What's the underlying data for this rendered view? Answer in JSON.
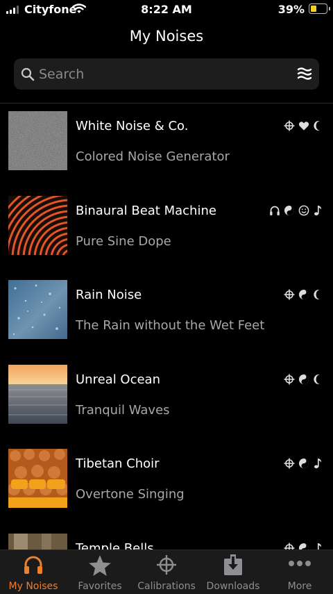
{
  "status": {
    "carrier": "Cityfone",
    "time": "8:22 AM",
    "battery": "39%",
    "battery_level": 0.39
  },
  "header": {
    "title": "My Noises"
  },
  "search": {
    "placeholder": "Search"
  },
  "items": [
    {
      "name": "White Noise & Co.",
      "subtitle": "Colored Noise Generator",
      "tags": [
        "crosshair-icon",
        "heart-icon",
        "moon-icon"
      ]
    },
    {
      "name": "Binaural Beat Machine",
      "subtitle": "Pure Sine Dope",
      "tags": [
        "headphones-icon",
        "yin-yang-icon",
        "smiley-icon",
        "music-note-icon"
      ]
    },
    {
      "name": "Rain Noise",
      "subtitle": "The Rain without the Wet Feet",
      "tags": [
        "crosshair-icon",
        "yin-yang-icon",
        "moon-icon"
      ]
    },
    {
      "name": "Unreal Ocean",
      "subtitle": "Tranquil Waves",
      "tags": [
        "crosshair-icon",
        "yin-yang-icon",
        "moon-icon"
      ]
    },
    {
      "name": "Tibetan Choir",
      "subtitle": "Overtone Singing",
      "tags": [
        "crosshair-icon",
        "yin-yang-icon",
        "music-note-icon"
      ]
    },
    {
      "name": "Temple Bells",
      "subtitle": "",
      "tags": [
        "crosshair-icon",
        "yin-yang-icon",
        "music-note-icon"
      ]
    }
  ],
  "tabs": [
    {
      "label": "My Noises",
      "icon": "headphones-icon",
      "active": true
    },
    {
      "label": "Favorites",
      "icon": "star-icon",
      "active": false
    },
    {
      "label": "Calibrations",
      "icon": "crosshair-icon",
      "active": false
    },
    {
      "label": "Downloads",
      "icon": "download-icon",
      "active": false
    },
    {
      "label": "More",
      "icon": "more-icon",
      "active": false
    }
  ],
  "colors": {
    "accent": "#f07f2d",
    "background": "#000000",
    "tabbar": "#1b1b1c",
    "search_bg": "#1d1d1e",
    "subtitle": "#a8a8a8"
  }
}
